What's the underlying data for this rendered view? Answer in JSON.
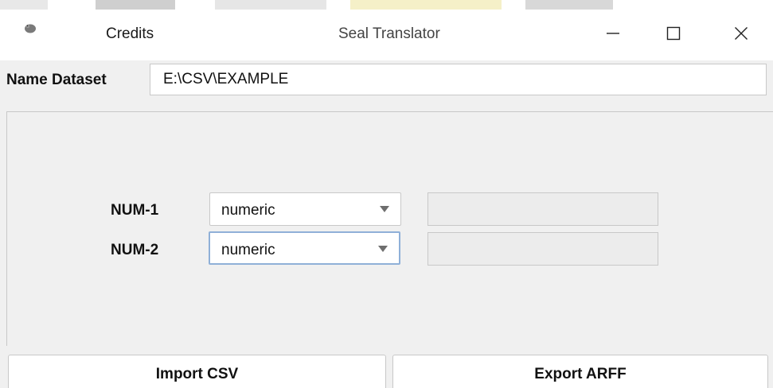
{
  "window": {
    "title": "Seal Translator",
    "menu_credits": "Credits",
    "icon": "seal-app-icon"
  },
  "dataset": {
    "label": "Name Dataset",
    "value": "E:\\CSV\\EXAMPLE"
  },
  "rows": [
    {
      "label": "NUM-1",
      "type": "numeric",
      "value": ""
    },
    {
      "label": "NUM-2",
      "type": "numeric",
      "value": ""
    }
  ],
  "buttons": {
    "import": "Import CSV",
    "export": "Export ARFF"
  },
  "colors": {
    "background": "#f0f0f0",
    "focus_border": "#8fb0d8"
  }
}
